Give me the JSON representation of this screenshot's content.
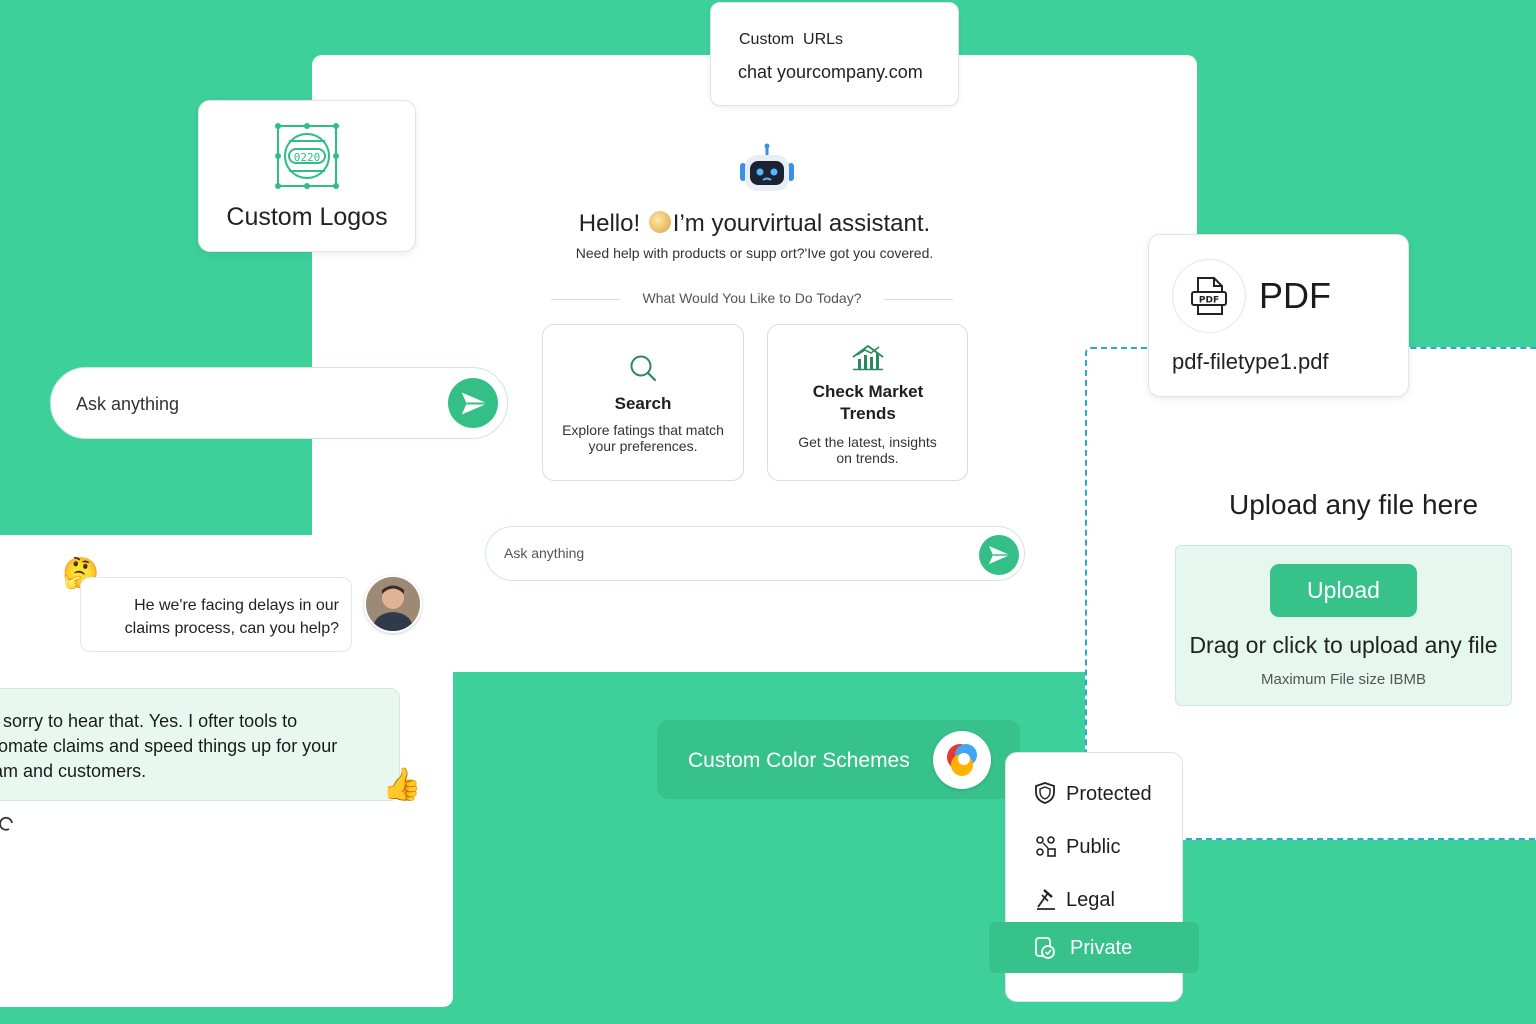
{
  "assistant": {
    "greeting_before": "Hello!",
    "greeting_after": "I’m yourvirtual assistant.",
    "subtitle": "Need help with products or supp ort?'Ive got you covered.",
    "prompt": "What Would You Like to Do Today?",
    "options": [
      {
        "title": "Search",
        "description": "Explore fatings that match your preferences.",
        "icon": "search-icon"
      },
      {
        "title": "Check Market Trends",
        "description": "Get the latest, insights on trends.",
        "icon": "chart-house-icon"
      }
    ],
    "ask_placeholder": "Ask anything"
  },
  "custom_urls": {
    "label": "Custom  URLs",
    "url": "chat yourcompany.com"
  },
  "custom_logos": {
    "label": "Custom Logos"
  },
  "pdf": {
    "type": "PDF",
    "filename": "pdf-filetype1.pdf"
  },
  "upload": {
    "title": "Upload any file here",
    "button": "Upload",
    "hint": "Drag or click to upload any file",
    "max_size": "Maximum File size IBMB"
  },
  "chat": {
    "user_message": "He we're facing delays in our claims process, can you help?",
    "bot_message": "m sorry to hear that. Yes. I ofter tools to\nutomate claims and speed things up for your\neam and customers.",
    "ask_placeholder": "Ask anything"
  },
  "color_schemes": {
    "label": "Custom Color Schemes"
  },
  "privacy": {
    "items": [
      {
        "label": "Protected",
        "icon": "shield-icon"
      },
      {
        "label": "Public",
        "icon": "people-icon"
      },
      {
        "label": "Legal",
        "icon": "gavel-icon"
      },
      {
        "label": "Private",
        "icon": "private-lock-icon"
      }
    ],
    "selected": "Private"
  },
  "colors": {
    "background": "#3dd09b",
    "accent": "#36c28a",
    "dashed_border": "#2aa9d6"
  }
}
